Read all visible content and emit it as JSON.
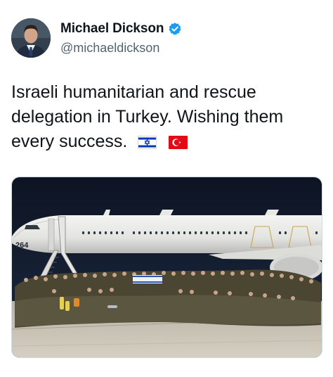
{
  "tweet": {
    "author": {
      "display_name": "Michael Dickson",
      "handle": "@michaeldickson",
      "verified": true,
      "avatar_icon": "person-avatar"
    },
    "text": "Israeli humanitarian and rescue delegation in Turkey. Wishing them every success.",
    "emoji": [
      "israel-flag",
      "turkey-flag"
    ],
    "media": {
      "type": "photo",
      "aircraft_tail_number": "264"
    }
  },
  "colors": {
    "verified_blue": "#1d9bf0",
    "handle_gray": "#536471",
    "text": "#0f1419",
    "israel_blue": "#0038b8",
    "turkey_red": "#e30a17"
  }
}
